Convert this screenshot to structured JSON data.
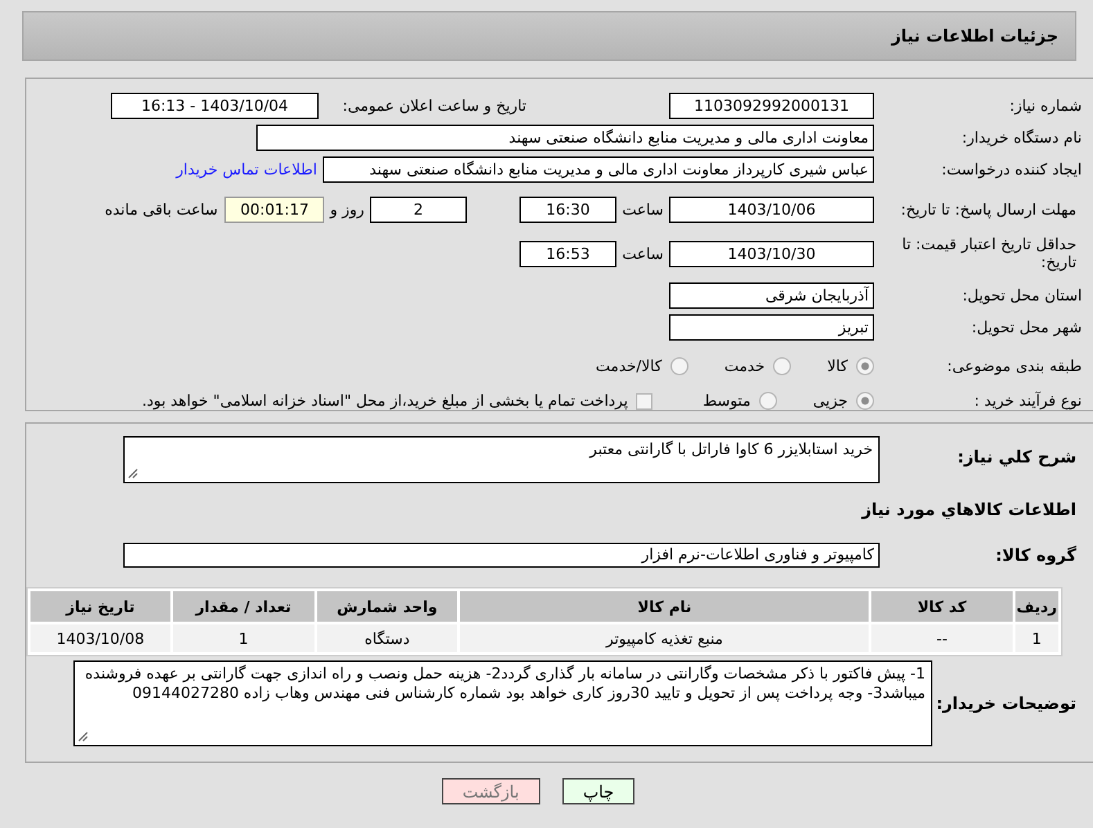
{
  "header": {
    "title": "جزئیات اطلاعات نیاز"
  },
  "details": {
    "need_number": {
      "label": "شماره نیاز:",
      "value": "1103092992000131"
    },
    "announce": {
      "label": "تاریخ و ساعت اعلان عمومی:",
      "value": "1403/10/04 - 16:13"
    },
    "buyer": {
      "label": "نام دستگاه خریدار:",
      "value": "معاونت اداری  مالی و مدیریت منابع دانشگاه صنعتی سهند"
    },
    "creator": {
      "label": "ایجاد کننده درخواست:",
      "value": "عباس شیری کارپرداز معاونت اداری  مالی و مدیریت منابع دانشگاه صنعتی سهند",
      "link": "اطلاعات تماس خریدار"
    },
    "deadline": {
      "label": "مهلت ارسال پاسخ: تا تاریخ:",
      "date": "1403/10/06",
      "time_label": "ساعت",
      "time": "16:30",
      "days": "2",
      "days_label": "روز و",
      "remaining": "00:01:17",
      "remaining_label": "ساعت باقی مانده"
    },
    "validity": {
      "label": "حداقل تاریخ اعتبار قیمت: تا تاریخ:",
      "date": "1403/10/30",
      "time_label": "ساعت",
      "time": "16:53"
    },
    "province": {
      "label": "استان محل تحویل:",
      "value": "آذربایجان شرقی"
    },
    "city": {
      "label": "شهر محل تحویل:",
      "value": "تبریز"
    },
    "category": {
      "label": "طبقه بندی موضوعی:",
      "options": [
        {
          "label": "کالا",
          "selected": true
        },
        {
          "label": "خدمت",
          "selected": false
        },
        {
          "label": "کالا/خدمت",
          "selected": false
        }
      ]
    },
    "process": {
      "label": "نوع فرآیند خرید :",
      "options": [
        {
          "label": "جزیی",
          "selected": true
        },
        {
          "label": "متوسط",
          "selected": false
        }
      ],
      "treasury": {
        "label": "پرداخت تمام یا بخشی از مبلغ خرید،از محل \"اسناد خزانه اسلامی\" خواهد بود.",
        "checked": false
      }
    }
  },
  "goods": {
    "summary": {
      "label": "شرح کلي نياز:",
      "value": "خرید استابلایزر 6 کاوا فاراتل با گارانتی معتبر"
    },
    "section_title": "اطلاعات کالاهاي مورد نياز",
    "group": {
      "label": "گروه کالا:",
      "value": "کامپیوتر و فناوری اطلاعات-نرم افزار"
    },
    "table": {
      "columns": [
        "ردیف",
        "کد کالا",
        "نام کالا",
        "واحد شمارش",
        "تعداد / مقدار",
        "تاریخ نیاز"
      ],
      "rows": [
        [
          "1",
          "--",
          "منبع تغذیه کامپیوتر",
          "دستگاه",
          "1",
          "1403/10/08"
        ]
      ]
    },
    "notes": {
      "label": "توضیحات خریدار:",
      "value": "1- پیش فاکتور با ذکر مشخصات وگارانتی در سامانه بار گذاری گردد2- هزینه حمل ونصب و راه اندازی جهت گارانتی بر عهده فروشنده میباشد3- وجه پرداخت پس از تحویل و تایید 30روز کاری خواهد بود شماره کارشناس فنی مهندس وهاب زاده 09144027280"
    }
  },
  "buttons": [
    {
      "kind": "print",
      "label": "چاپ"
    },
    {
      "kind": "back",
      "label": "بازگشت"
    }
  ]
}
